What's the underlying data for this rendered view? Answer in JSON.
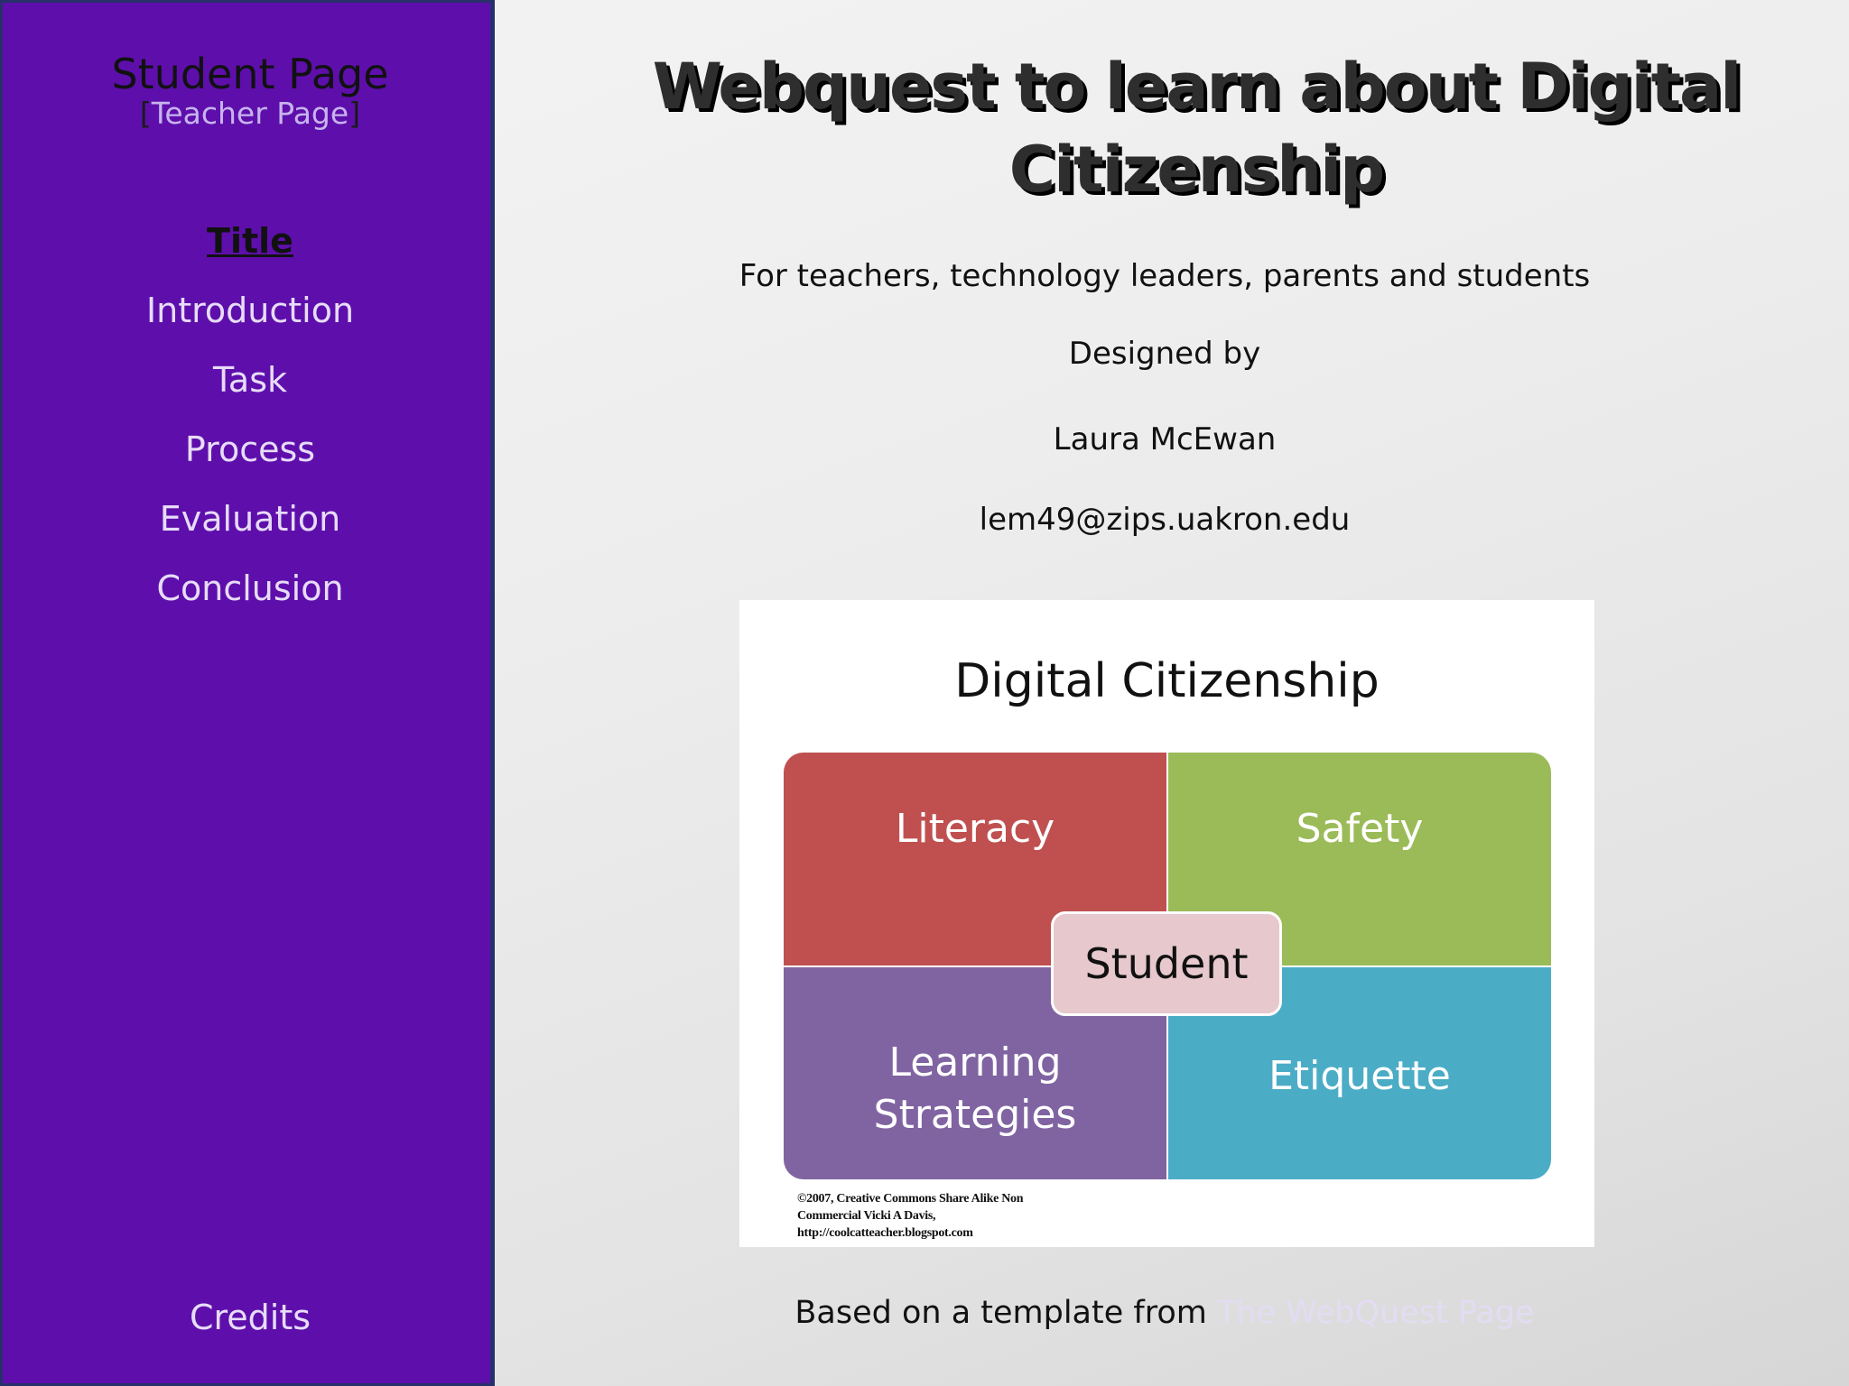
{
  "sidebar": {
    "title": "Student Page",
    "teacher_prefix": "[",
    "teacher_link": "Teacher Page",
    "teacher_suffix": "]",
    "nav": [
      {
        "label": "Title",
        "active": true
      },
      {
        "label": "Introduction"
      },
      {
        "label": "Task"
      },
      {
        "label": "Process"
      },
      {
        "label": "Evaluation"
      },
      {
        "label": "Conclusion"
      }
    ],
    "credits": "Credits"
  },
  "main": {
    "title": "Webquest to learn about Digital Citizenship",
    "audience": "For  teachers, technology leaders, parents and students",
    "designed_by": "Designed by",
    "author": "Laura McEwan",
    "email": "lem49@zips.uakron.edu"
  },
  "image": {
    "title": "Digital Citizenship",
    "quadrants": {
      "literacy": "Literacy",
      "safety": "Safety",
      "learning": "Learning Strategies",
      "etiquette": "Etiquette"
    },
    "center": "Student",
    "copyright_lines": [
      "©2007, Creative Commons Share Alike Non",
      "Commercial Vicki A Davis,",
      "http://coolcatteacher.blogspot.com"
    ],
    "colors": {
      "literacy": "#c05050",
      "safety": "#9bbb59",
      "learning": "#8064a2",
      "etiquette": "#4bacc6",
      "center": "#e6c8cd"
    }
  },
  "footer": {
    "text": "Based on a template from ",
    "link": "The WebQuest Page"
  },
  "colors": {
    "sidebar_bg": "#5e0fab",
    "nav_text": "#e7dcf8"
  }
}
